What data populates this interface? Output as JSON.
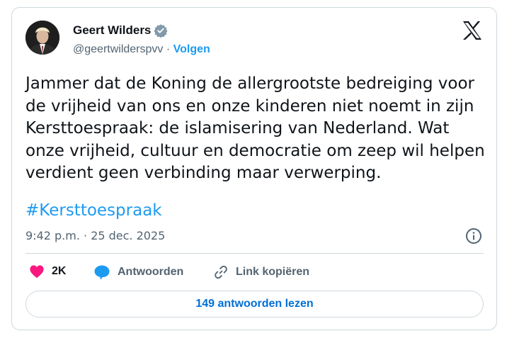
{
  "author": {
    "name": "Geert Wilders",
    "handle": "@geertwilderspvv",
    "separator": "·",
    "follow_label": "Volgen"
  },
  "tweet": {
    "text": "Jammer dat de Koning de allergrootste bedreiging voor de vrijheid van ons en onze kinderen niet noemt in zijn Kersttoespraak: de islamisering van Nederland. Wat onze vrijheid, cultuur en democratie om zeep wil helpen verdient geen verbinding maar verwerping.",
    "hashtag": "#Kersttoespraak",
    "timestamp": "9:42 p.m. · 25 dec. 2025"
  },
  "actions": {
    "like_count": "2K",
    "reply_label": "Antwoorden",
    "copy_link_label": "Link kopiëren"
  },
  "replies_button": "149 antwoorden lezen",
  "colors": {
    "accent": "#1d9bf0",
    "like": "#f91880",
    "muted": "#536471",
    "border": "#cfd9de"
  }
}
